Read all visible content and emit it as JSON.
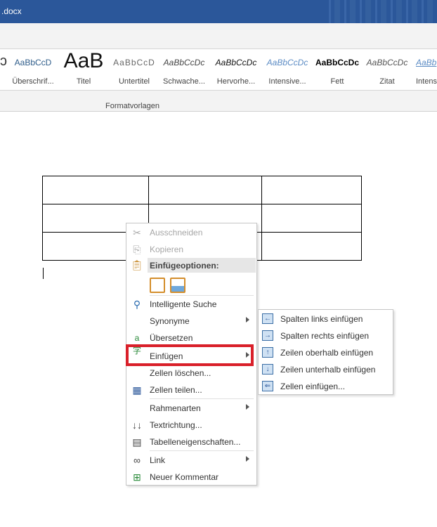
{
  "window": {
    "title": ".docx"
  },
  "ribbon": {
    "styles": [
      {
        "preview": "AaBbCcD",
        "name": "Überschrif..."
      },
      {
        "preview": "AaB",
        "name": "Titel"
      },
      {
        "preview": "AaBbCcD",
        "name": "Untertitel"
      },
      {
        "preview": "AaBbCcDc",
        "name": "Schwache..."
      },
      {
        "preview": "AaBbCcDc",
        "name": "Hervorhe..."
      },
      {
        "preview": "AaBbCcDc",
        "name": "Intensive..."
      },
      {
        "preview": "AaBbCcDc",
        "name": "Fett"
      },
      {
        "preview": "AaBbCcDc",
        "name": "Zitat"
      },
      {
        "preview": "AaBb",
        "name": "Intens"
      }
    ],
    "group_label": "Formatvorlagen"
  },
  "context_menu": {
    "cut": "Ausschneiden",
    "copy": "Kopieren",
    "paste_header": "Einfügeoptionen:",
    "smart_lookup": "Intelligente Suche",
    "synonyms": "Synonyme",
    "translate": "Übersetzen",
    "insert": "Einfügen",
    "delete_cells": "Zellen löschen...",
    "split_cells": "Zellen teilen...",
    "border_styles": "Rahmenarten",
    "text_direction": "Textrichtung...",
    "table_properties": "Tabelleneigenschaften...",
    "link": "Link",
    "new_comment": "Neuer Kommentar"
  },
  "insert_submenu": [
    "Spalten links einfügen",
    "Spalten rechts einfügen",
    "Zeilen oberhalb einfügen",
    "Zeilen unterhalb einfügen",
    "Zellen einfügen..."
  ],
  "colors": {
    "titlebar": "#2b579a",
    "highlight": "#d9202a"
  }
}
